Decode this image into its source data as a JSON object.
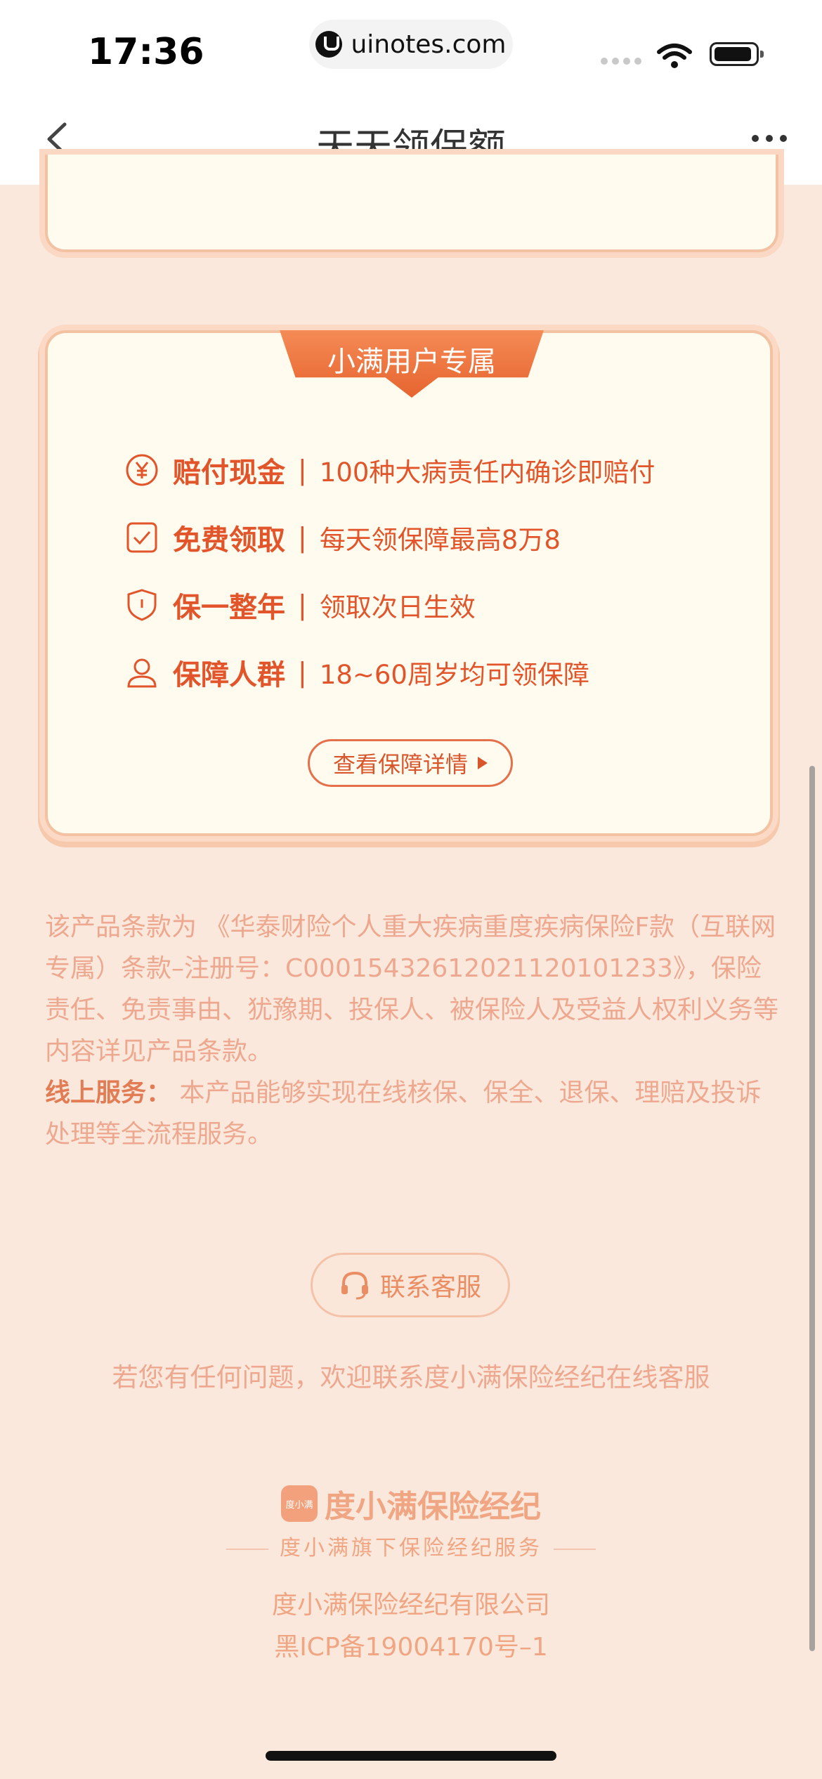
{
  "status_bar": {
    "time": "17:36",
    "url": "uinotes.com"
  },
  "nav": {
    "title": "天天领保额"
  },
  "card": {
    "ribbon_label": "小满用户专属",
    "features": [
      {
        "icon": "yen-circle-icon",
        "name": "赔付现金",
        "sep": "|",
        "desc": "100种大病责任内确诊即赔付"
      },
      {
        "icon": "check-box-icon",
        "name": "免费领取",
        "sep": "|",
        "desc": "每天领保障最高8万8"
      },
      {
        "icon": "shield-icon",
        "name": "保一整年",
        "sep": "|",
        "desc": "领取次日生效"
      },
      {
        "icon": "person-icon",
        "name": "保障人群",
        "sep": "|",
        "desc": "18~60周岁均可领保障"
      }
    ],
    "detail_button": "查看保障详情"
  },
  "terms": {
    "text": "该产品条款为 《华泰财险个人重大疾病重度疾病保险F款（互联网专属）条款–注册号：C00015432612021120101233》，保险责任、免责事由、犹豫期、投保人、被保险人及受益人权利义务等内容详见产品条款。",
    "service_label": "线上服务：",
    "service_text": " 本产品能够实现在线核保、保全、退保、理赔及投诉处理等全流程服务。"
  },
  "contact": {
    "button": "联系客服",
    "note": "若您有任何问题，欢迎联系度小满保险经纪在线客服"
  },
  "footer": {
    "logo_text": "度小满",
    "brand_name": "度小满保险经纪",
    "subtitle": "度小满旗下保险经纪服务",
    "company": "度小满保险经纪有限公司",
    "icp": "黑ICP备19004170号–1"
  },
  "colors": {
    "accent": "#e2552b",
    "background": "#fbe8dc",
    "card": "#fffbee"
  }
}
